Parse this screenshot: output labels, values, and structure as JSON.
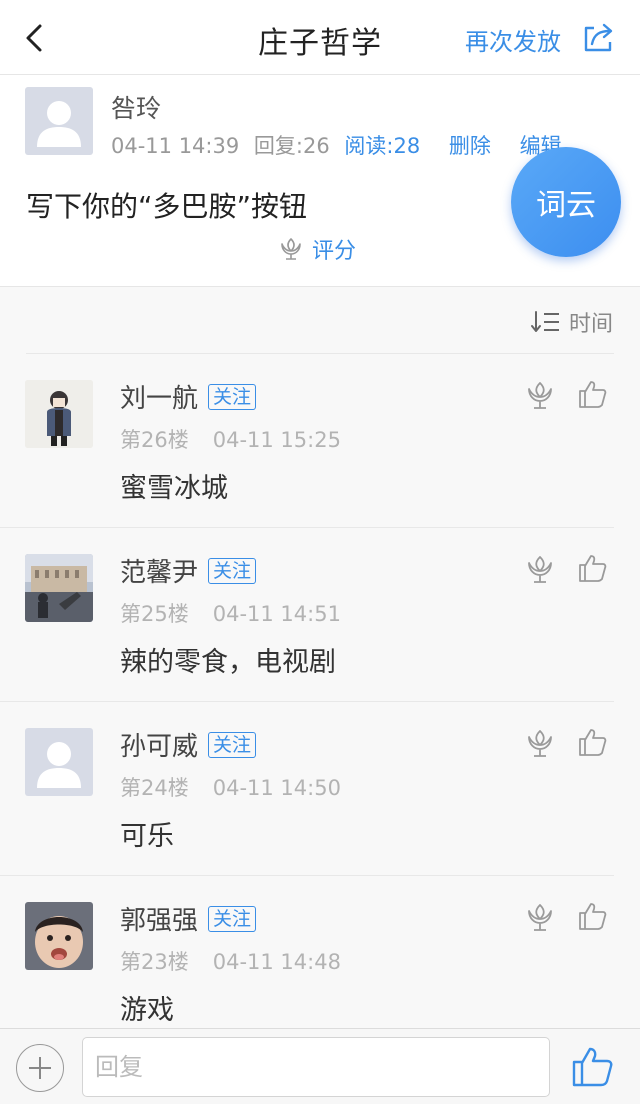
{
  "header": {
    "title": "庄子哲学",
    "resend_label": "再次发放"
  },
  "post": {
    "author": "咎玲",
    "date": "04-11 14:39",
    "replies": "回复:26",
    "reads": "阅读:28",
    "delete_label": "删除",
    "edit_label": "编辑",
    "content": "写下你的“多巴胺”按钮",
    "rate_label": "评分",
    "wordcloud_label": "词云"
  },
  "sort": {
    "label": "时间"
  },
  "comments": [
    {
      "name": "刘一航",
      "follow": "关注",
      "floor": "第26楼",
      "time": "04-11 15:25",
      "text": "蜜雪冰城",
      "avatar": "boy-illustration"
    },
    {
      "name": "范馨尹",
      "follow": "关注",
      "floor": "第25楼",
      "time": "04-11 14:51",
      "text": "辣的零食，电视剧",
      "avatar": "city-photo"
    },
    {
      "name": "孙可威",
      "follow": "关注",
      "floor": "第24楼",
      "time": "04-11 14:50",
      "text": "可乐",
      "avatar": "default-placeholder"
    },
    {
      "name": "郭强强",
      "follow": "关注",
      "floor": "第23楼",
      "time": "04-11 14:48",
      "text": "游戏",
      "avatar": "baby-photo"
    }
  ],
  "reply": {
    "placeholder": "回复"
  },
  "colors": {
    "accent": "#3a8ee6",
    "fab": "#4a9df4"
  }
}
